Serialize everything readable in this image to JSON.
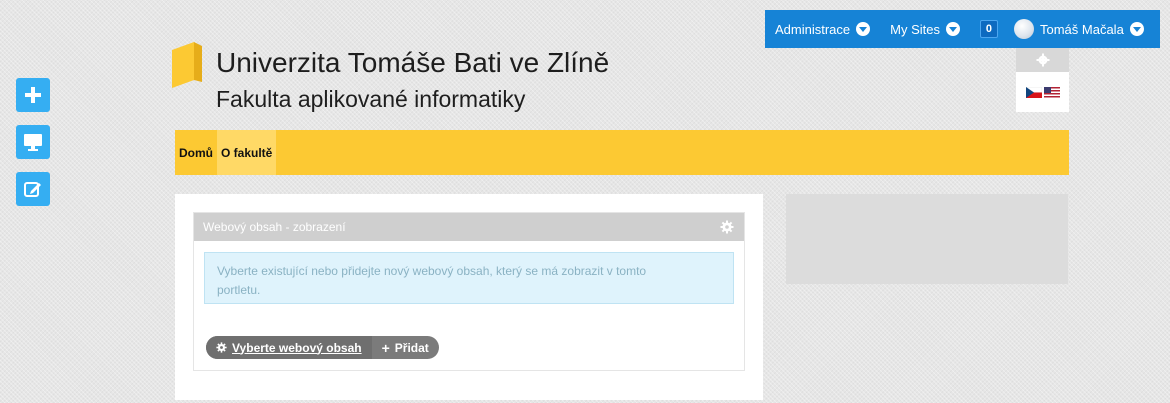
{
  "dockbar": {
    "admin_label": "Administrace",
    "sites_label": "My Sites",
    "notifications_count": "0",
    "user_name": "Tomáš Mačala"
  },
  "header": {
    "university": "Univerzita Tomáše Bati ve Zlíně",
    "faculty": "Fakulta aplikované informatiky"
  },
  "nav": {
    "items": [
      {
        "label": "Domů"
      },
      {
        "label": "O fakultě"
      }
    ]
  },
  "portlet": {
    "title": "Webový obsah - zobrazení",
    "info_line1": "Vyberte existující nebo přidejte nový webový obsah, který se má zobrazit v tomto",
    "info_line2": "portletu.",
    "select_label": "Vyberte webový obsah",
    "add_label": "Přidat"
  },
  "colors": {
    "dockbar": "#1683d6",
    "nav": "#fcc933",
    "tool_button": "#35aef2"
  },
  "icons": [
    "add-icon",
    "preview-icon",
    "edit-icon",
    "gear-icon",
    "czech-flag-icon",
    "us-flag-icon",
    "logo-book-icon"
  ]
}
